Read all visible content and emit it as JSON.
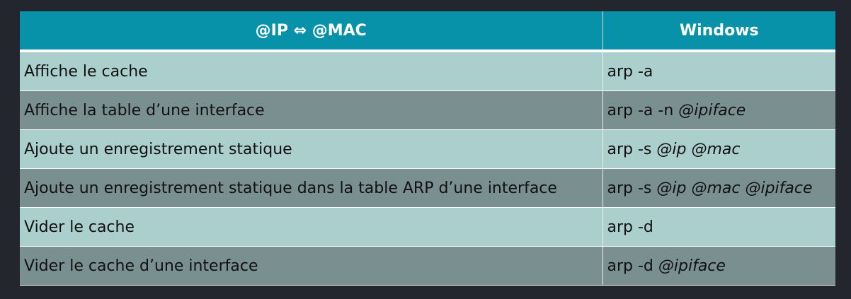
{
  "table": {
    "headers": [
      "@IP ⇔ @MAC",
      "Windows"
    ],
    "rows": [
      {
        "action": "Affiche le cache",
        "cmd": "arp -a",
        "args": ""
      },
      {
        "action": "Affiche la table d’une interface",
        "cmd": "arp -a -n ",
        "args": "@ipiface"
      },
      {
        "action": "Ajoute un enregistrement statique",
        "cmd": "arp -s ",
        "args": "@ip @mac"
      },
      {
        "action": "Ajoute un enregistrement statique dans la table ARP d’une interface",
        "cmd": "arp -s ",
        "args": "@ip @mac @ipiface"
      },
      {
        "action": "Vider le cache",
        "cmd": "arp -d",
        "args": ""
      },
      {
        "action": "Vider le cache d’une interface",
        "cmd": "arp -d ",
        "args": "@ipiface"
      }
    ]
  },
  "colors": {
    "background": "#23262e",
    "header": "#0892a9",
    "row_light": "#abcfcc",
    "row_dark": "#7a8f8f"
  }
}
